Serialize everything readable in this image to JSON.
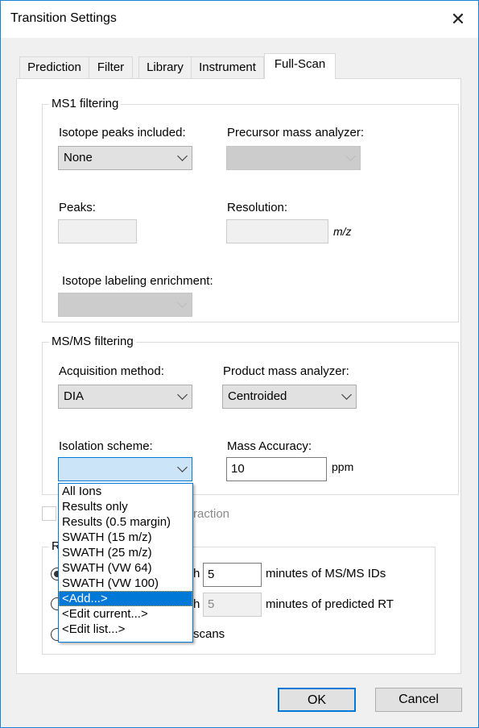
{
  "window": {
    "title": "Transition Settings",
    "close_icon": "close-icon"
  },
  "tabs": [
    {
      "label": "Prediction"
    },
    {
      "label": "Filter"
    },
    {
      "label": "Library"
    },
    {
      "label": "Instrument"
    },
    {
      "label": "Full-Scan",
      "selected": true
    }
  ],
  "ms1": {
    "title": "MS1 filtering",
    "isotope_peaks_label": "Isotope peaks included:",
    "isotope_peaks_value": "None",
    "precursor_analyzer_label": "Precursor mass analyzer:",
    "peaks_label": "Peaks:",
    "resolution_label": "Resolution:",
    "resolution_unit": "m/z",
    "enrichment_label": "Isotope labeling enrichment:"
  },
  "msms": {
    "title": "MS/MS filtering",
    "acquisition_label": "Acquisition method:",
    "acquisition_value": "DIA",
    "product_analyzer_label": "Product mass analyzer:",
    "product_analyzer_value": "Centroided",
    "isolation_label": "Isolation scheme:",
    "isolation_value": "",
    "mass_accuracy_label": "Mass Accuracy:",
    "mass_accuracy_value": "10",
    "mass_accuracy_unit": "ppm"
  },
  "isolation_options": [
    "All Ions",
    "Results only",
    "Results (0.5 margin)",
    "SWATH (15 m/z)",
    "SWATH (25 m/z)",
    "SWATH (VW 64)",
    "SWATH (VW 100)",
    "<Add...>",
    "<Edit current...>",
    "<Edit list...>"
  ],
  "highlighted_option": "<Add...>",
  "checkbox": {
    "label_fragment": "raction",
    "checked": false
  },
  "retention": {
    "title_fragment": "R",
    "radio1_fragment": "h",
    "radio1_value": "5",
    "radio1_suffix": "minutes of MS/MS IDs",
    "radio2_fragment": "h",
    "radio2_value": "5",
    "radio2_suffix": "minutes of predicted RT",
    "radio3_fragment": "scans",
    "selected": 1
  },
  "buttons": {
    "ok": "OK",
    "cancel": "Cancel"
  }
}
